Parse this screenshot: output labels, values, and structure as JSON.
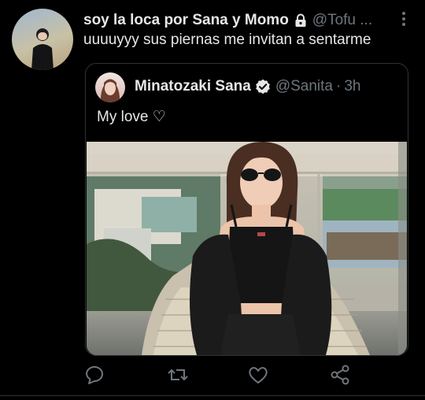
{
  "tweet": {
    "author_name": "soy la loca por Sana y Momo",
    "author_handle": "@Tofu ...",
    "protected_icon": "lock-icon",
    "more_icon": "more-vertical-icon",
    "text": "uuuuyyy sus piernas me invitan a sentarme"
  },
  "quoted_tweet": {
    "author_name": "Minatozaki Sana",
    "verified_icon": "verified-badge-icon",
    "author_handle": "@Sanita",
    "separator": "·",
    "time": "3h",
    "text": "My love ♡",
    "media": "photo"
  },
  "actions": [
    {
      "icon": "reply-icon"
    },
    {
      "icon": "retweet-icon"
    },
    {
      "icon": "like-icon"
    },
    {
      "icon": "share-icon"
    }
  ],
  "colors": {
    "background": "#000000",
    "text_primary": "#e7e7e7",
    "text_secondary": "#6e767d",
    "border": "#2f3336"
  }
}
